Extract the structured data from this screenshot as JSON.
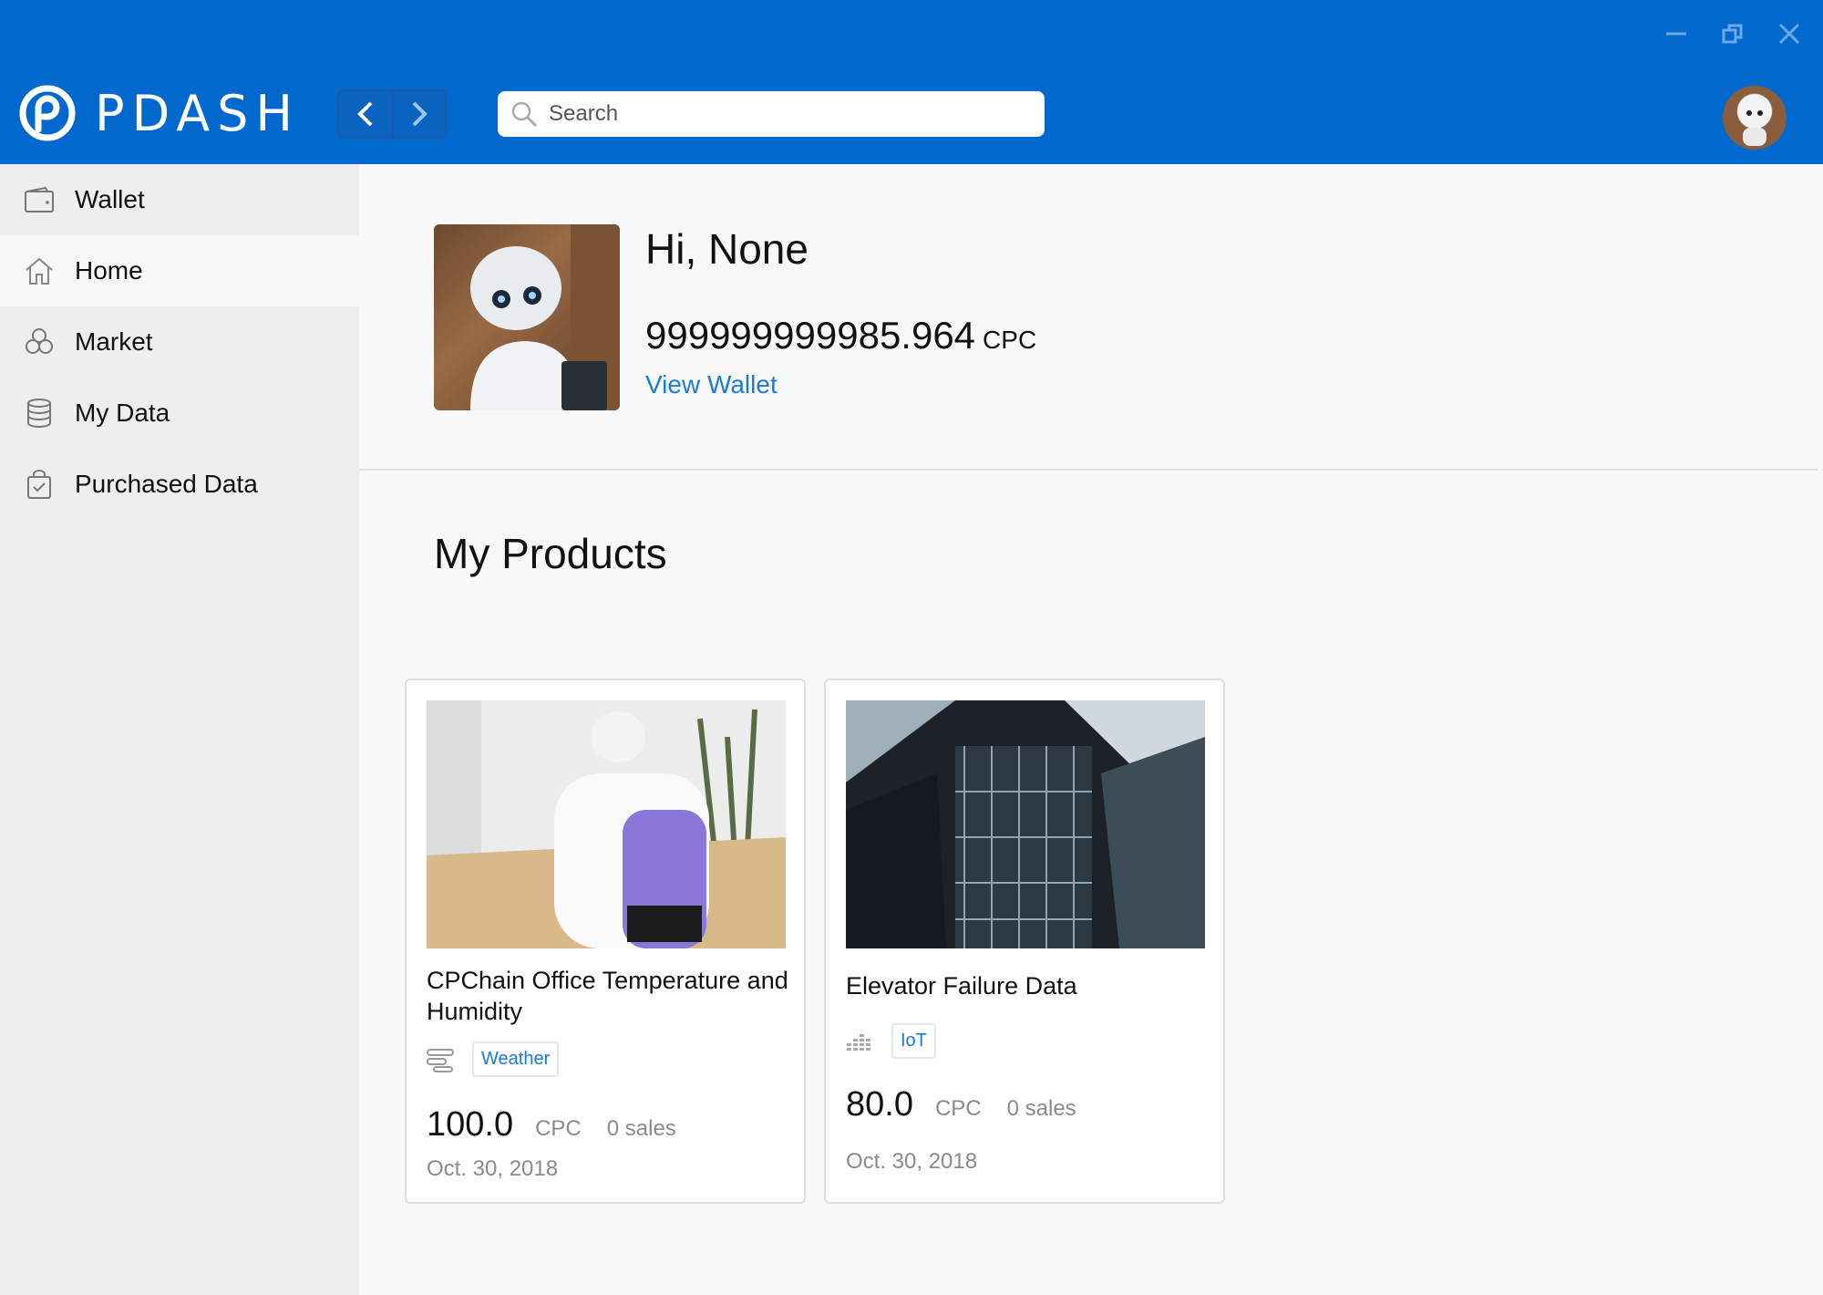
{
  "app": {
    "brand": "PDASH"
  },
  "header": {
    "search_placeholder": "Search",
    "window_controls": [
      "minimize-icon",
      "restore-icon",
      "close-icon"
    ],
    "nav": [
      "back-arrow-icon",
      "forward-arrow-icon"
    ]
  },
  "sidebar": {
    "items": [
      {
        "label": "Wallet",
        "icon": "wallet-icon",
        "active": false
      },
      {
        "label": "Home",
        "icon": "home-icon",
        "active": true
      },
      {
        "label": "Market",
        "icon": "market-icon",
        "active": false
      },
      {
        "label": "My Data",
        "icon": "database-icon",
        "active": false
      },
      {
        "label": "Purchased Data",
        "icon": "purchased-bag-icon",
        "active": false
      }
    ]
  },
  "profile": {
    "greeting": "Hi, None",
    "balance": "999999999985.964",
    "balance_unit": "CPC",
    "view_wallet": "View Wallet"
  },
  "products": {
    "title": "My Products",
    "items": [
      {
        "title": "CPChain Office Temperature and Humidity",
        "tag": "Weather",
        "tag_icon": "sliders-icon",
        "price": "100.0",
        "unit": "CPC",
        "sales": "0 sales",
        "date": "Oct. 30, 2018"
      },
      {
        "title": "Elevator Failure Data",
        "tag": "IoT",
        "tag_icon": "equalizer-icon",
        "price": "80.0",
        "unit": "CPC",
        "sales": "0 sales",
        "date": "Oct. 30, 2018"
      }
    ]
  },
  "colors": {
    "header": "#0169ce",
    "accent": "#1b7bd8",
    "sidebar": "#eeeeee"
  }
}
